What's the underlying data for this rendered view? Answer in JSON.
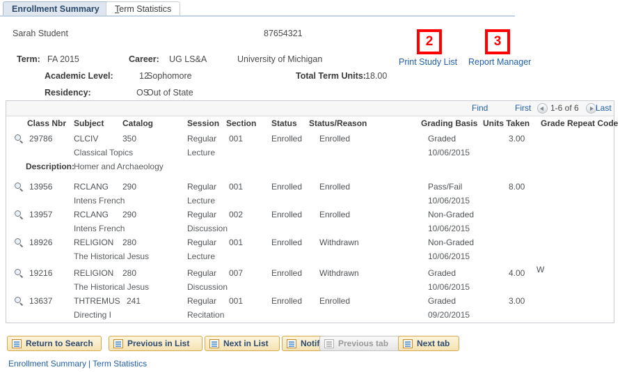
{
  "tabs": [
    {
      "label": "Enrollment Summary",
      "active": true
    },
    {
      "label": "Term Statistics",
      "active": false,
      "accesskey": "T"
    }
  ],
  "header": {
    "student_name": "Sarah Student",
    "student_id": "87654321",
    "term_label": "Term:",
    "term_value": "FA 2015",
    "career_label": "Career:",
    "career_value": "UG LS&A",
    "institution": "University of Michigan",
    "academic_level_label": "Academic Level:",
    "academic_level_value": "12",
    "academic_level_desc": "Sophomore",
    "total_units_label": "Total Term Units:",
    "total_units_value": "18.00",
    "residency_label": "Residency:",
    "residency_value": "OS",
    "residency_desc": "Out of State"
  },
  "actions": {
    "print_study_list": "Print Study List",
    "report_manager": "Report Manager"
  },
  "annotations": [
    {
      "number": "2",
      "target": "Print Study List",
      "color": "#ff0000"
    },
    {
      "number": "3",
      "target": "Report Manager",
      "color": "#ff0000"
    }
  ],
  "grid_nav": {
    "find": "Find",
    "first": "First",
    "range": "1-6 of 6",
    "last": "Last",
    "prev_icon": "left-arrow-icon",
    "next_icon": "right-arrow-icon"
  },
  "grid": {
    "columns": [
      "Class Nbr",
      "Subject",
      "Catalog",
      "Session",
      "Section",
      "Status",
      "Status/Reason",
      "Grading Basis",
      "Units Taken",
      "Grade",
      "Repeat Code"
    ],
    "rows": [
      {
        "class_nbr": "29786",
        "subject": "CLCIV",
        "catalog": "350",
        "course_title": "Classical Topics",
        "session": "Regular",
        "component": "Lecture",
        "section": "001",
        "status": "Enrolled",
        "status_reason": "Enrolled",
        "grading_basis": "Graded",
        "grading_date": "10/06/2015",
        "units_taken": "3.00",
        "grade": "",
        "repeat_code": "",
        "description_label": "Description:",
        "description": "Homer and Archaeology"
      },
      {
        "class_nbr": "13956",
        "subject": "RCLANG",
        "catalog": "290",
        "course_title": "Intens French",
        "session": "Regular",
        "component": "Lecture",
        "section": "001",
        "status": "Enrolled",
        "status_reason": "Enrolled",
        "grading_basis": "Pass/Fail",
        "grading_date": "10/06/2015",
        "units_taken": "8.00",
        "grade": "",
        "repeat_code": ""
      },
      {
        "class_nbr": "13957",
        "subject": "RCLANG",
        "catalog": "290",
        "course_title": "Intens French",
        "session": "Regular",
        "component": "Discussion",
        "section": "002",
        "status": "Enrolled",
        "status_reason": "Enrolled",
        "grading_basis": "Non-Graded",
        "grading_date": "10/06/2015",
        "units_taken": "",
        "grade": "",
        "repeat_code": ""
      },
      {
        "class_nbr": "18926",
        "subject": "RELIGION",
        "catalog": "280",
        "course_title": "The Historical Jesus",
        "session": "Regular",
        "component": "Lecture",
        "section": "001",
        "status": "Enrolled",
        "status_reason": "Withdrawn",
        "grading_basis": "Non-Graded",
        "grading_date": "10/06/2015",
        "units_taken": "",
        "grade": "",
        "repeat_code": ""
      },
      {
        "class_nbr": "19216",
        "subject": "RELIGION",
        "catalog": "280",
        "course_title": "The Historical Jesus",
        "session": "Regular",
        "component": "Discussion",
        "section": "007",
        "status": "Enrolled",
        "status_reason": "Withdrawn",
        "grading_basis": "Graded",
        "grading_date": "10/06/2015",
        "units_taken": "4.00",
        "grade": "W",
        "repeat_code": ""
      },
      {
        "class_nbr": "13637",
        "subject": "THTREMUS",
        "catalog": "241",
        "course_title": "Directing I",
        "session": "Regular",
        "component": "Recitation",
        "section": "001",
        "status": "Enrolled",
        "status_reason": "Enrolled",
        "grading_basis": "Graded",
        "grading_date": "09/20/2015",
        "units_taken": "3.00",
        "grade": "",
        "repeat_code": ""
      }
    ]
  },
  "buttons": [
    {
      "label": "Return to Search",
      "icon": "search-return-icon",
      "disabled": false
    },
    {
      "label": "Previous in List",
      "icon": "up-list-icon",
      "disabled": false
    },
    {
      "label": "Next in List",
      "icon": "down-list-icon",
      "disabled": false
    },
    {
      "label": "Notify",
      "icon": "notify-icon",
      "disabled": false
    },
    {
      "label": "Previous tab",
      "icon": "previous-tab-icon",
      "disabled": true
    },
    {
      "label": "Next tab",
      "icon": "next-tab-icon",
      "disabled": false
    }
  ],
  "footer": {
    "link1": "Enrollment Summary",
    "separator": "|",
    "link2": "Term Statistics"
  }
}
